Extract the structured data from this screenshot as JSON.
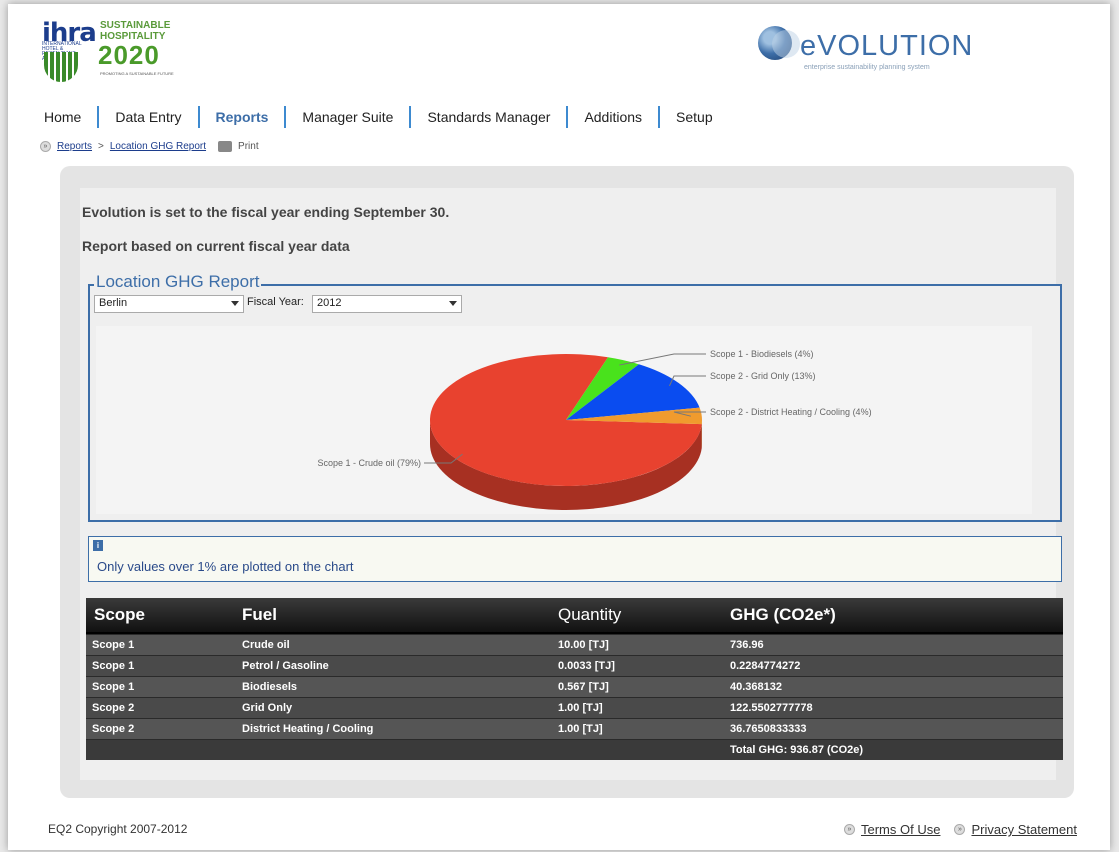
{
  "logos": {
    "ihra": "ihra",
    "ihra_small": "INTERNATIONAL HOTEL & RESTAURANT ASSOCIATION",
    "sh_line1": "SUSTAINABLE",
    "sh_line2": "HOSPITALITY",
    "sh_year": "2020",
    "sh_sub": "PROMOTING A SUSTAINABLE FUTURE",
    "evo": "eVOLUTION",
    "evo_sub": "enterprise sustainability planning system"
  },
  "nav": {
    "items": [
      "Home",
      "Data Entry",
      "Reports",
      "Manager Suite",
      "Standards Manager",
      "Additions",
      "Setup"
    ],
    "active": "Reports"
  },
  "breadcrumb": {
    "reports": "Reports",
    "separator": ">",
    "current": "Location GHG Report",
    "print": "Print"
  },
  "notices": {
    "fiscal": "Evolution is set to the fiscal year ending September 30.",
    "basis": "Report based on current fiscal year data"
  },
  "report": {
    "legend": "Location GHG Report",
    "location_value": "Berlin",
    "fy_label": "Fiscal Year:",
    "fy_value": "2012"
  },
  "chart_data": {
    "type": "pie",
    "categories": [
      "Scope 1 - Crude oil",
      "Scope 1 - Biodiesels",
      "Scope 2 - Grid Only",
      "Scope 2 - District Heating / Cooling"
    ],
    "values": [
      79,
      4,
      13,
      4
    ],
    "labels": [
      "Scope 1 - Crude oil (79%)",
      "Scope 1 - Biodiesels (4%)",
      "Scope 2 - Grid Only (13%)",
      "Scope 2 - District Heating / Cooling (4%)"
    ],
    "colors": [
      "#e8422f",
      "#49e21c",
      "#0a4cf0",
      "#f09b2e"
    ]
  },
  "info": {
    "text": "Only values over 1% are plotted on the chart"
  },
  "table": {
    "headers": [
      "Scope",
      "Fuel",
      "Quantity",
      "GHG (CO2e*)"
    ],
    "rows": [
      [
        "Scope 1",
        "Crude oil",
        "10.00 [TJ]",
        "736.96"
      ],
      [
        "Scope 1",
        "Petrol / Gasoline",
        "0.0033 [TJ]",
        "0.2284774272"
      ],
      [
        "Scope 1",
        "Biodiesels",
        "0.567 [TJ]",
        "40.368132"
      ],
      [
        "Scope 2",
        "Grid Only",
        "1.00 [TJ]",
        "122.5502777778"
      ],
      [
        "Scope 2",
        "District Heating / Cooling",
        "1.00 [TJ]",
        "36.7650833333"
      ]
    ],
    "total": "Total GHG: 936.87 (CO2e)"
  },
  "footer": {
    "copyright": "EQ2 Copyright 2007-2012",
    "terms": "Terms Of Use",
    "privacy": "Privacy Statement"
  }
}
